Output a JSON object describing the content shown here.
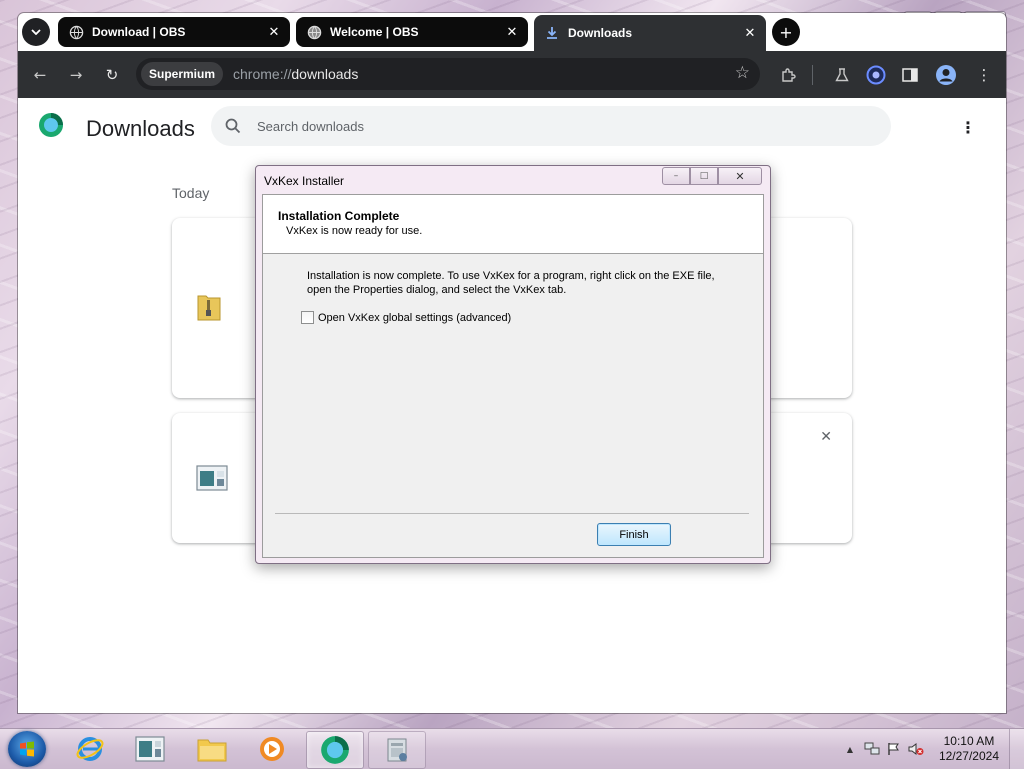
{
  "desktop": {
    "window_controls": {
      "minimize": "–",
      "maximize": "□",
      "close": "✕"
    }
  },
  "browser": {
    "tab_menu_icon": "chevron-down-icon",
    "tabs": [
      {
        "label": "Download | OBS",
        "icon": "globe-icon",
        "close": "✕",
        "active": false
      },
      {
        "label": "Welcome | OBS",
        "icon": "globe-icon",
        "close": "✕",
        "active": false
      },
      {
        "label": "Downloads",
        "icon": "download-icon",
        "close": "✕",
        "active": true
      }
    ],
    "new_tab": "+",
    "toolbar": {
      "back": "←",
      "forward": "→",
      "reload": "↻",
      "chip": "Supermium",
      "url_scheme": "chrome://",
      "url_path": "downloads",
      "star": "☆",
      "extensions_icon": "puzzle-icon",
      "labs_icon": "flask-icon",
      "profile_badge_icon": "extension-badge-icon",
      "sidepanel_icon": "side-panel-icon",
      "account_icon": "account-icon",
      "menu": "⋮"
    }
  },
  "downloads_page": {
    "title": "Downloads",
    "search_placeholder": "Search downloads",
    "menu": "⋮",
    "section_label": "Today",
    "cards": [
      {
        "icon": "zip-folder-icon"
      },
      {
        "icon": "installer-app-icon",
        "close": "✕"
      }
    ]
  },
  "dialog": {
    "title": "VxKex Installer",
    "controls": {
      "minimize": "–",
      "maximize": "□",
      "close": "✕"
    },
    "header_title": "Installation Complete",
    "header_subtitle": "VxKex is now ready for use.",
    "message_line1": "Installation is now complete. To use VxKex for a program, right click on the EXE file,",
    "message_line2": "open the Properties dialog, and select the VxKex tab.",
    "checkbox_label": "Open VxKex global settings (advanced)",
    "checkbox_checked": false,
    "finish_button": "Finish"
  },
  "taskbar": {
    "items": [
      {
        "name": "internet-explorer-icon"
      },
      {
        "name": "control-panel-icon"
      },
      {
        "name": "file-explorer-icon"
      },
      {
        "name": "media-player-icon"
      },
      {
        "name": "supermium-browser-icon",
        "active": true
      },
      {
        "name": "vxkex-installer-icon",
        "open": true
      }
    ],
    "tray": {
      "expand": "▲",
      "time": "10:10 AM",
      "date": "12/27/2024"
    }
  }
}
